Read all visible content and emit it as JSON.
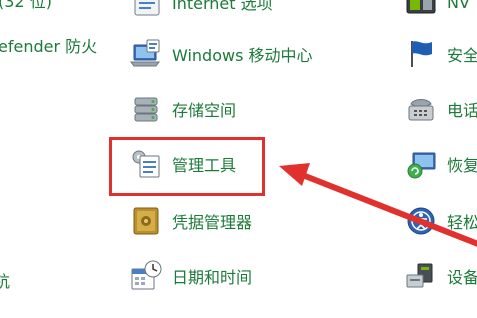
{
  "left_column": {
    "row1": "(32 位)",
    "row2": "efender 防火",
    "row6": "钪"
  },
  "middle_column": {
    "items": [
      {
        "label": "Internet 选项"
      },
      {
        "label": "Windows 移动中心"
      },
      {
        "label": "存储空间"
      },
      {
        "label": "管理工具"
      },
      {
        "label": "凭据管理器"
      },
      {
        "label": "日期和时间"
      }
    ]
  },
  "right_column": {
    "items": [
      {
        "label": "NV"
      },
      {
        "label": "安全"
      },
      {
        "label": "电话"
      },
      {
        "label": "恢复"
      },
      {
        "label": "轻松"
      },
      {
        "label": "设备"
      }
    ]
  },
  "colors": {
    "link_text": "#1c7a3a",
    "highlight": "#e0312f"
  },
  "icons": {
    "internet_options": "globe-options-icon",
    "mobility_center": "laptop-icon",
    "storage_spaces": "drive-stack-icon",
    "admin_tools": "admin-tools-icon",
    "credential_manager": "vault-icon",
    "date_time": "calendar-clock-icon",
    "nvidia": "nvidia-panel-icon",
    "security": "flag-icon",
    "phone": "phone-icon",
    "recovery": "recovery-icon",
    "ease_of_access": "ease-of-access-icon",
    "devices": "devices-icon"
  }
}
